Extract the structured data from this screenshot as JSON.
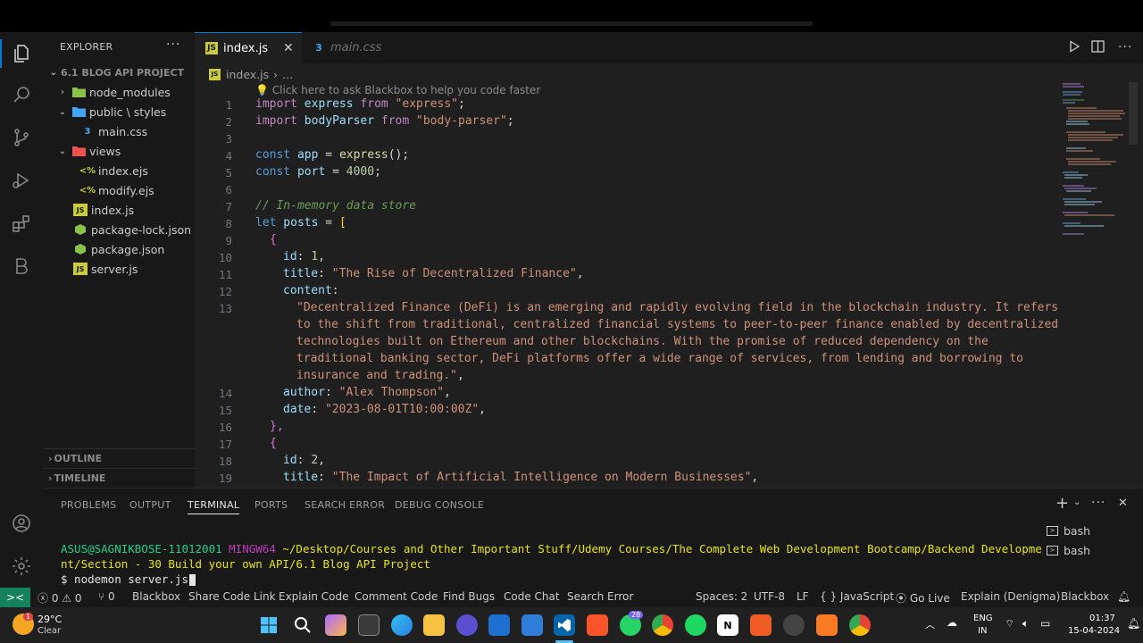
{
  "sidebar": {
    "title": "EXPLORER",
    "project": "6.1 BLOG API PROJECT",
    "items": [
      {
        "label": "node_modules",
        "type": "folder",
        "indent": 1,
        "expanded": false
      },
      {
        "label": "public \\ styles",
        "type": "folder",
        "indent": 1,
        "expanded": true
      },
      {
        "label": "main.css",
        "type": "css",
        "indent": 2
      },
      {
        "label": "views",
        "type": "folder-red",
        "indent": 1,
        "expanded": true
      },
      {
        "label": "index.ejs",
        "type": "ejs",
        "indent": 2
      },
      {
        "label": "modify.ejs",
        "type": "ejs",
        "indent": 2
      },
      {
        "label": "index.js",
        "type": "js",
        "indent": 1
      },
      {
        "label": "package-lock.json",
        "type": "json",
        "indent": 1
      },
      {
        "label": "package.json",
        "type": "json",
        "indent": 1
      },
      {
        "label": "server.js",
        "type": "js",
        "indent": 1
      }
    ],
    "outline": "OUTLINE",
    "timeline": "TIMELINE"
  },
  "tabs": [
    {
      "label": "index.js",
      "icon": "JS",
      "active": true
    },
    {
      "label": "main.css",
      "icon": "css",
      "active": false
    }
  ],
  "breadcrumb": {
    "file": "index.js",
    "rest": "..."
  },
  "hint": "Click here to ask Blackbox to help you code faster",
  "line_numbers": [
    "1",
    "2",
    "3",
    "4",
    "5",
    "6",
    "7",
    "8",
    "9",
    "10",
    "11",
    "12",
    "13",
    "",
    "",
    "",
    "",
    "14",
    "15",
    "16",
    "17",
    "18",
    "19"
  ],
  "code": {
    "l1_import": "import",
    "l1_name": " express ",
    "l1_from": "from",
    "l1_str": " \"express\"",
    "l1_end": ";",
    "l2_import": "import",
    "l2_name": " bodyParser ",
    "l2_from": "from",
    "l2_str": " \"body-parser\"",
    "l2_end": ";",
    "l4_const": "const",
    "l4_name": " app ",
    "l4_eq": "= ",
    "l4_fn": "express",
    "l4_end": "();",
    "l5_const": "const",
    "l5_name": " port ",
    "l5_eq": "= ",
    "l5_num": "4000",
    "l5_end": ";",
    "l7_comment": "// In-memory data store",
    "l8_let": "let",
    "l8_name": " posts ",
    "l8_eq": "= ",
    "l8_br": "[",
    "l9_br": "{",
    "l10_key": "id",
    "l10_sep": ": ",
    "l10_num": "1",
    "l10_end": ",",
    "l11_key": "title",
    "l11_sep": ": ",
    "l11_str": "\"The Rise of Decentralized Finance\"",
    "l11_end": ",",
    "l12_key": "content",
    "l12_sep": ":",
    "l13a": "\"Decentralized Finance (DeFi) is an emerging and rapidly evolving field in the blockchain industry. It refers",
    "l13b": "to the shift from traditional, centralized financial systems to peer-to-peer finance enabled by decentralized",
    "l13c": "technologies built on Ethereum and other blockchains. With the promise of reduced dependency on the",
    "l13d": "traditional banking sector, DeFi platforms offer a wide range of services, from lending and borrowing to",
    "l13e": "insurance and trading.\"",
    "l13e_end": ",",
    "l14_key": "author",
    "l14_sep": ": ",
    "l14_str": "\"Alex Thompson\"",
    "l14_end": ",",
    "l15_key": "date",
    "l15_sep": ": ",
    "l15_str": "\"2023-08-01T10:00:00Z\"",
    "l15_end": ",",
    "l16_br": "},",
    "l17_br": "{",
    "l18_key": "id",
    "l18_sep": ": ",
    "l18_num": "2",
    "l18_end": ",",
    "l19_key": "title",
    "l19_sep": ": ",
    "l19_str": "\"The Impact of Artificial Intelligence on Modern Businesses\"",
    "l19_end": ","
  },
  "panel": {
    "tabs": [
      "PROBLEMS",
      "OUTPUT",
      "TERMINAL",
      "PORTS",
      "SEARCH ERROR",
      "DEBUG CONSOLE"
    ],
    "active_tab": "TERMINAL",
    "prompt_user": "ASUS@SAGNIKBOSE-11012001",
    "prompt_env": "MINGW64",
    "prompt_path_1": "~/Desktop/Courses and Other Important Stuff/Udemy Courses/The Complete Web Development Bootcamp/Backend Developme",
    "prompt_path_2": "nt/Section - 30 Build your own API/6.1 Blog API Project",
    "command": "$ nodemon server.js",
    "terminals": [
      "bash",
      "bash"
    ]
  },
  "status": {
    "errors": "0",
    "warnings": "0",
    "ports": "0",
    "items_left": [
      "Blackbox",
      "Share Code Link",
      "Explain Code",
      "Comment Code",
      "Find Bugs",
      "Code Chat",
      "Search Error"
    ],
    "spaces": "Spaces: 2",
    "encoding": "UTF-8",
    "eol": "LF",
    "language": "JavaScript",
    "golive": "Go Live",
    "explain": "Explain (Denigma)",
    "blackbox": "Blackbox"
  },
  "taskbar": {
    "temp": "29°C",
    "weather": "Clear",
    "weather_badge": "1",
    "teams_badge": "28",
    "lang": "ENG",
    "region": "IN",
    "time": "01:37",
    "date": "15-04-2024"
  }
}
